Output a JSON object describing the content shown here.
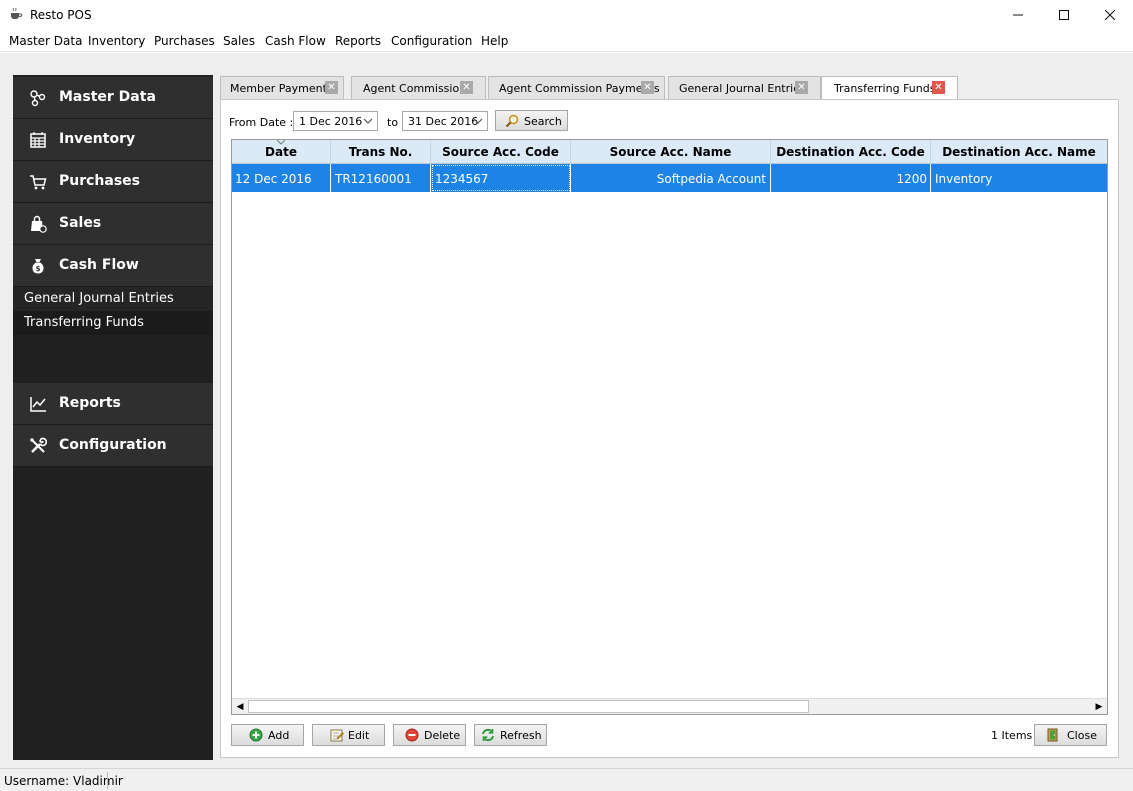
{
  "window": {
    "title": "Resto POS"
  },
  "menu": [
    "Master Data",
    "Inventory",
    "Purchases",
    "Sales",
    "Cash Flow",
    "Reports",
    "Configuration",
    "Help"
  ],
  "sidebar": {
    "items": [
      {
        "label": "Master Data",
        "icon": "network-icon"
      },
      {
        "label": "Inventory",
        "icon": "calendar-icon"
      },
      {
        "label": "Purchases",
        "icon": "cart-icon"
      },
      {
        "label": "Sales",
        "icon": "shopping-bag-icon"
      },
      {
        "label": "Cash Flow",
        "icon": "money-bag-icon"
      },
      {
        "label": "Reports",
        "icon": "line-chart-icon"
      },
      {
        "label": "Configuration",
        "icon": "tools-icon"
      }
    ],
    "cashflow_subitems": [
      "General Journal Entries",
      "Transferring Funds"
    ],
    "selected_subitem": "Transferring Funds"
  },
  "tabs": [
    {
      "label": "Member Payments"
    },
    {
      "label": "Agent Commissions"
    },
    {
      "label": "Agent Commission Payments"
    },
    {
      "label": "General Journal Entries"
    },
    {
      "label": "Transferring Funds"
    }
  ],
  "active_tab": "Transferring Funds",
  "filter": {
    "from_label": "From Date :",
    "from_value": "1 Dec 2016",
    "to_label": "to",
    "to_value": "31 Dec 2016",
    "search_label": "Search"
  },
  "table": {
    "columns": [
      "Date",
      "Trans No.",
      "Source Acc. Code",
      "Source Acc. Name",
      "Destination Acc. Code",
      "Destination Acc. Name"
    ],
    "rows": [
      [
        "12 Dec 2016",
        "TR12160001",
        "1234567",
        "Softpedia Account",
        "1200",
        "Inventory"
      ]
    ]
  },
  "actions": {
    "add": "Add",
    "edit": "Edit",
    "delete": "Delete",
    "refresh": "Refresh",
    "close": "Close"
  },
  "items_count": "1 Items",
  "status": {
    "username": "Username: Vladimir"
  },
  "colors": {
    "sidebar_bg": "#202020",
    "selection": "#1d84e6",
    "header_bg": "#dceaf7",
    "tab_close_active": "#e0574c"
  }
}
